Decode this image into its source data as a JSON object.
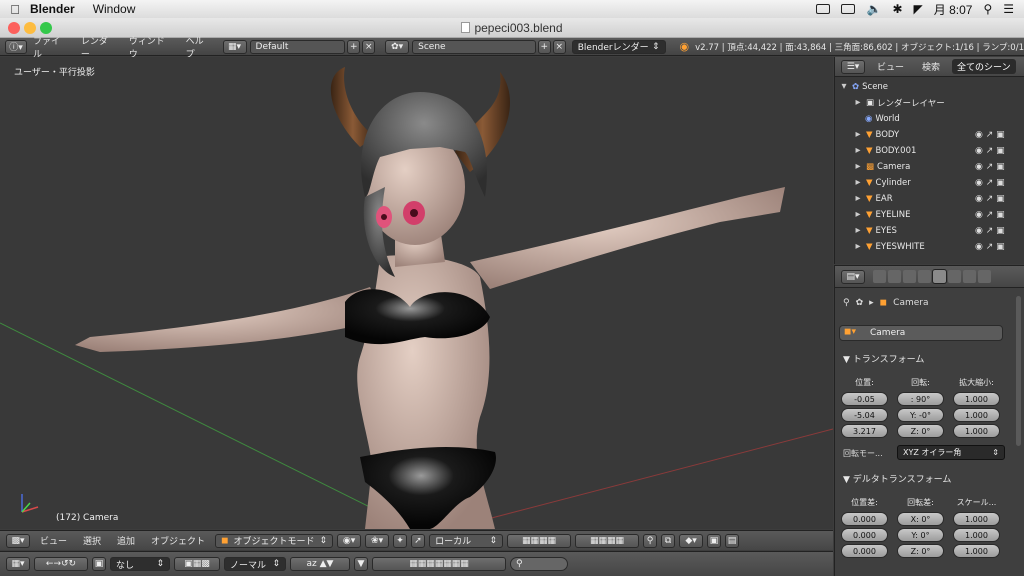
{
  "menubar": {
    "app_name": "Blender",
    "menu_window": "Window",
    "clock": "月 8:07"
  },
  "window": {
    "title": "pepeci003.blend"
  },
  "info_header": {
    "menus": [
      "ファイル",
      "レンダー",
      "ウィンドウ",
      "ヘルプ"
    ],
    "screen_layout": "Default",
    "scene": "Scene",
    "render_engine": "Blenderレンダー",
    "stats": "v2.77 | 頂点:44,422 | 面:43,864 | 三角面:86,602 | オブジェクト:1/16 | ランプ:0/1"
  },
  "viewport": {
    "view_label": "ユーザー・平行投影",
    "object_label": "(172) Camera"
  },
  "view3d_header": {
    "menus": [
      "ビュー",
      "選択",
      "追加",
      "オブジェクト"
    ],
    "mode": "オブジェクトモード",
    "orientation": "ローカル"
  },
  "timeline_header": {
    "keying": "なし",
    "sync": "ノーマル"
  },
  "outliner": {
    "tabs": [
      "ビュー",
      "検索",
      "全てのシーン"
    ],
    "items": [
      {
        "label": "Scene",
        "icon": "scene-icon"
      },
      {
        "label": "レンダーレイヤー",
        "icon": "render-layer-icon"
      },
      {
        "label": "World",
        "icon": "world-icon"
      },
      {
        "label": "BODY",
        "icon": "mesh-icon"
      },
      {
        "label": "BODY.001",
        "icon": "mesh-icon"
      },
      {
        "label": "Camera",
        "icon": "camera-icon"
      },
      {
        "label": "Cylinder",
        "icon": "mesh-icon"
      },
      {
        "label": "EAR",
        "icon": "mesh-icon"
      },
      {
        "label": "EYELINE",
        "icon": "mesh-icon"
      },
      {
        "label": "EYES",
        "icon": "mesh-icon"
      },
      {
        "label": "EYESWHITE",
        "icon": "mesh-icon"
      }
    ]
  },
  "properties": {
    "breadcrumb": "Camera",
    "object_name": "Camera",
    "transform": {
      "title": "トランスフォーム",
      "location_label": "位置:",
      "rotation_label": "回転:",
      "scale_label": "拡大縮小:",
      "location": [
        "-0.05",
        "-5.04",
        "3.217"
      ],
      "rotation": [
        ": 90°",
        "Y: -0°",
        "Z: 0°"
      ],
      "scale": [
        "1.000",
        "1.000",
        "1.000"
      ],
      "rotation_mode_label": "回転モー...",
      "rotation_mode": "XYZ オイラー角"
    },
    "delta": {
      "title": "デルタトランスフォーム",
      "location_label": "位置差:",
      "rotation_label": "回転差:",
      "scale_label": "スケール...",
      "location": [
        "0.000",
        "0.000",
        "0.000"
      ],
      "rotation": [
        "X: 0°",
        "Y: 0°",
        "Z: 0°"
      ],
      "scale": [
        "1.000",
        "1.000",
        "1.000"
      ]
    }
  },
  "colors": {
    "viewport_bg": "#393939",
    "panel_bg": "#3f3f3f",
    "accent": "#ffa133",
    "skin": "#cdb3a6"
  }
}
